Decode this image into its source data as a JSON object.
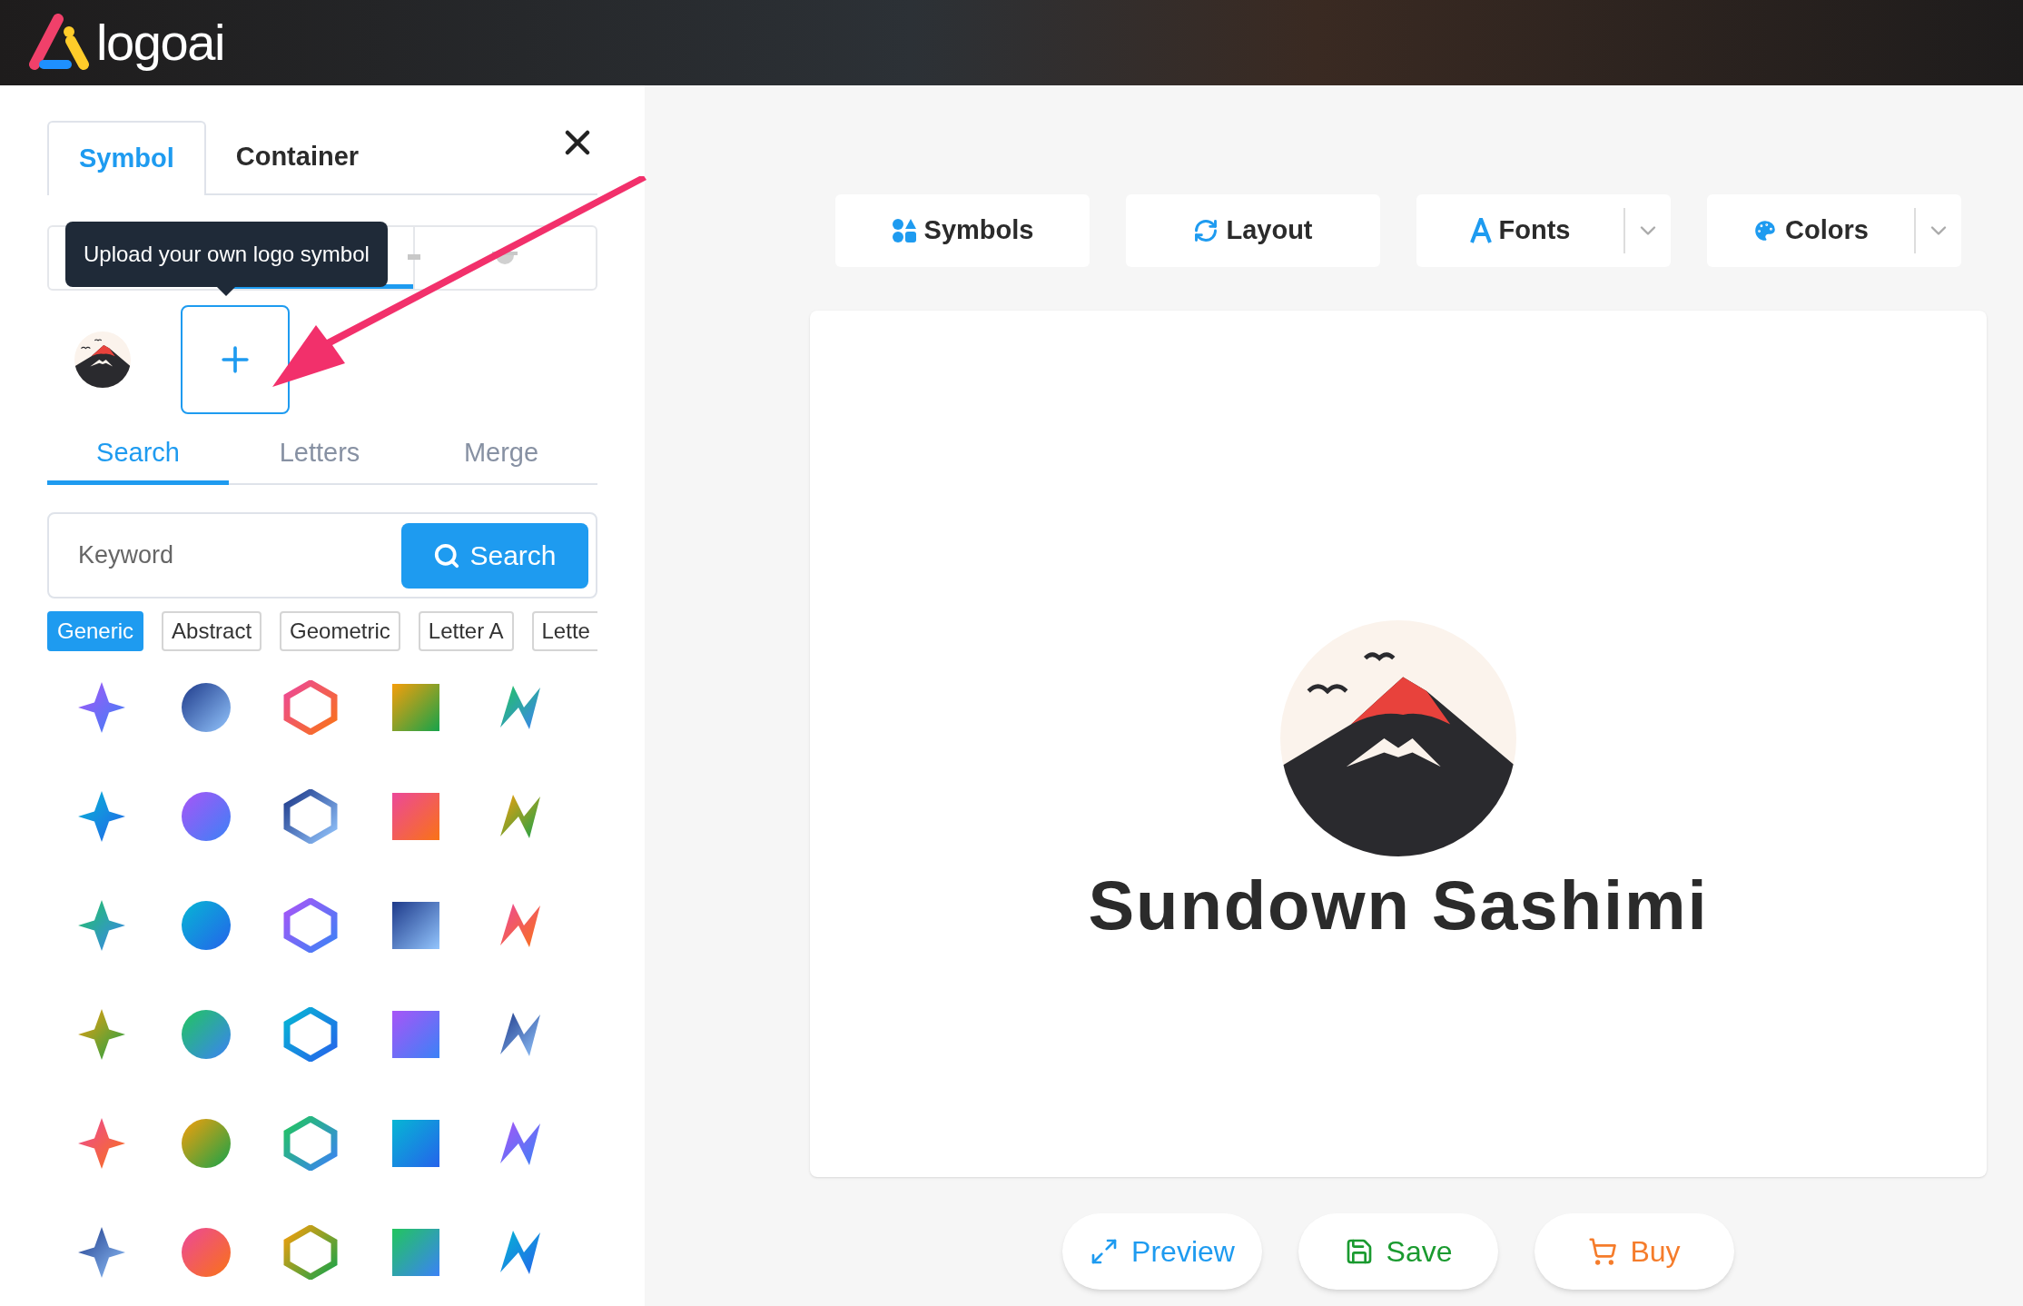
{
  "header": {
    "brand": "logoai"
  },
  "panel": {
    "tabs": [
      {
        "label": "Symbol",
        "selected": true
      },
      {
        "label": "Container",
        "selected": false
      }
    ],
    "tooltip": "Upload your own logo symbol",
    "subtabs": [
      {
        "label": "Search",
        "selected": true
      },
      {
        "label": "Letters",
        "selected": false
      },
      {
        "label": "Merge",
        "selected": false
      }
    ],
    "search": {
      "placeholder": "Keyword",
      "button": "Search"
    },
    "chips": [
      {
        "label": "Generic",
        "selected": true
      },
      {
        "label": "Abstract",
        "selected": false
      },
      {
        "label": "Geometric",
        "selected": false
      },
      {
        "label": "Letter A",
        "selected": false
      },
      {
        "label": "Lette",
        "selected": false
      }
    ]
  },
  "toolbar": [
    {
      "label": "Symbols",
      "kind": "symbols",
      "dropdown": false
    },
    {
      "label": "Layout",
      "kind": "layout",
      "dropdown": false
    },
    {
      "label": "Fonts",
      "kind": "fonts",
      "dropdown": true
    },
    {
      "label": "Colors",
      "kind": "colors",
      "dropdown": true
    }
  ],
  "canvas": {
    "title": "Sundown Sashimi"
  },
  "actions": [
    {
      "label": "Preview",
      "kind": "preview"
    },
    {
      "label": "Save",
      "kind": "save"
    },
    {
      "label": "Buy",
      "kind": "buy"
    }
  ]
}
